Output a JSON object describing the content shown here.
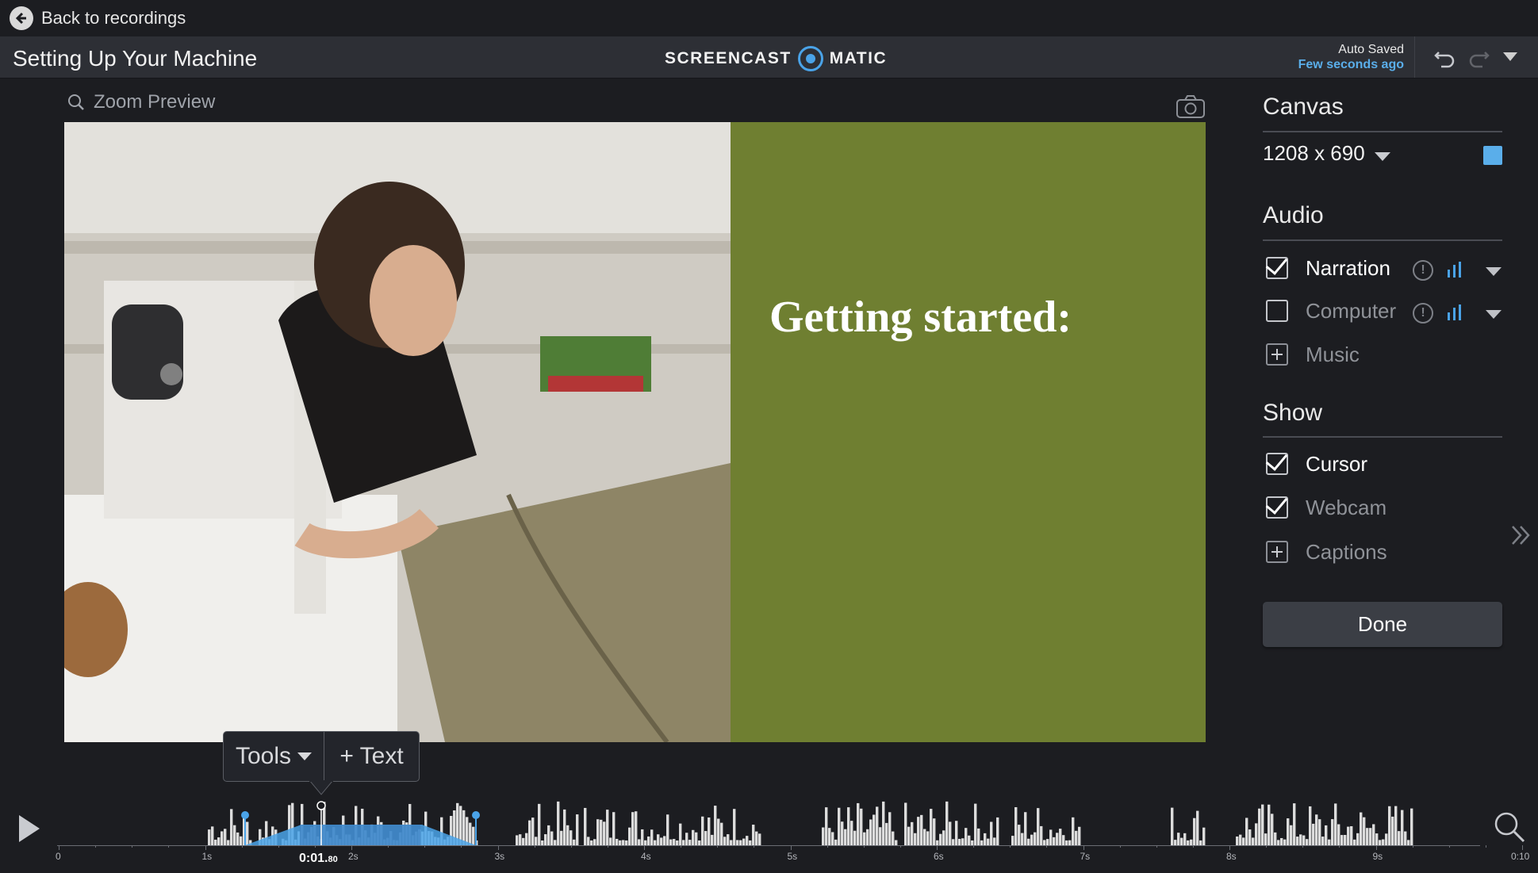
{
  "topbar": {
    "back_label": "Back to recordings"
  },
  "titlebar": {
    "doc_title": "Setting Up Your Machine",
    "logo_left": "SCREENCAST",
    "logo_right": "MATIC",
    "autosave_title": "Auto Saved",
    "autosave_time": "Few seconds ago"
  },
  "preview": {
    "zoom_label": "Zoom Preview",
    "slide_text": "Getting started:",
    "slide_color": "#6f7f31"
  },
  "panel": {
    "canvas_title": "Canvas",
    "canvas_size": "1208 x 690",
    "canvas_color": "#5aaeea",
    "audio_title": "Audio",
    "audio_items": [
      {
        "label": "Narration",
        "checked": true
      },
      {
        "label": "Computer",
        "checked": false
      },
      {
        "label": "Music",
        "type": "add"
      }
    ],
    "show_title": "Show",
    "show_items": [
      {
        "label": "Cursor",
        "checked": true
      },
      {
        "label": "Webcam",
        "checked": true
      },
      {
        "label": "Captions",
        "type": "add"
      }
    ],
    "done_label": "Done"
  },
  "timeline": {
    "tools_label": "Tools",
    "text_label": "+ Text",
    "time_main": "0:01.",
    "time_frac": "80",
    "ticks": [
      "0",
      "1s",
      "2s",
      "3s",
      "4s",
      "5s",
      "6s",
      "7s",
      "8s",
      "9s",
      "0:10"
    ],
    "accent": "#4aa3e8"
  }
}
